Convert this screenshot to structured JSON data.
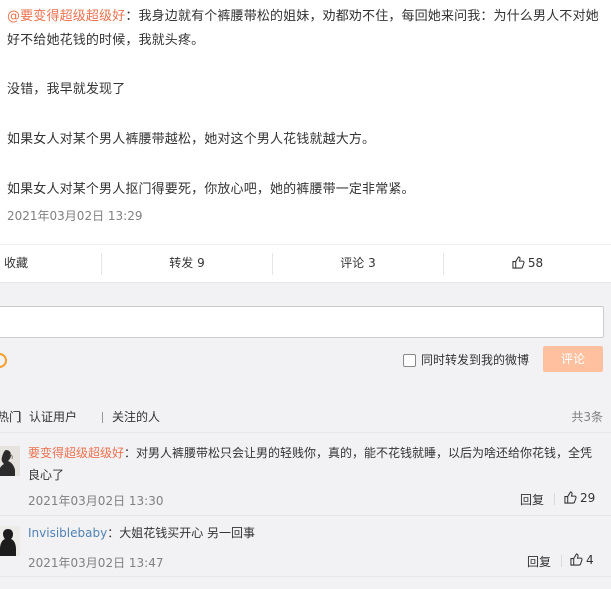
{
  "post": {
    "author": "@要变得超级超级好",
    "first_line_text": "：我身边就有个裤腰带松的姐妹，劝都劝不住，每回她来问我：为什么男人不对她好不给她花钱的时候，我就头疼。",
    "paragraphs": [
      "没错，我早就发现了",
      "如果女人对某个男人裤腰带越松，她对这个男人花钱就越大方。",
      "如果女人对某个男人抠门得要死，你放心吧，她的裤腰带一定非常紧。"
    ],
    "time": "2021年03月02日 13:29"
  },
  "actions": {
    "favorite": "收藏",
    "forward": "转发 9",
    "comment": "评论 3",
    "likes": "58"
  },
  "comment_box": {
    "forward_label": "同时转发到我的微博",
    "submit_label": "评论"
  },
  "tabs": {
    "hot": "热门",
    "verified": "认证用户",
    "following": "关注的人",
    "total": "共3条"
  },
  "comments": [
    {
      "name": "要变得超级超级好",
      "text": "：对男人裤腰带松只会让男的轻贱你，真的，能不花钱就睡，以后为啥还给你花钱，全凭良心了",
      "time": "2021年03月02日 13:30",
      "reply": "回复",
      "likes": "29"
    },
    {
      "name": "Invisiblebaby",
      "text": "：大姐花钱买开心 另一回事",
      "time": "2021年03月02日 13:47",
      "reply": "回复",
      "likes": "4"
    }
  ],
  "colors": {
    "accent": "#eb7350",
    "link": "#5082b4",
    "submit_disabled": "#ffc09f",
    "panel_bg": "#f2f2f5"
  },
  "icons": {
    "like": "thumbs-up-icon",
    "emoji": "smiley-icon"
  }
}
